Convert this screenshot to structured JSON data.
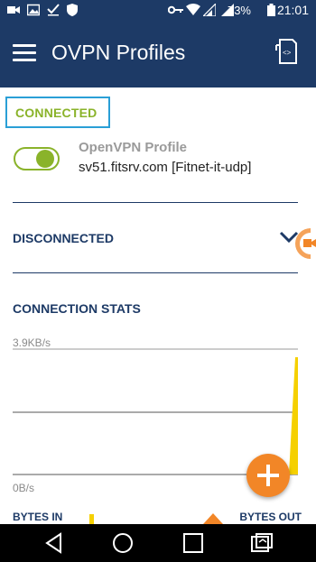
{
  "status_bar": {
    "battery_percent": "73%",
    "time": "21:01"
  },
  "app_bar": {
    "title": "OVPN Profiles"
  },
  "connected_section": {
    "header": "CONNECTED",
    "profile": {
      "name": "OpenVPN Profile",
      "server": "sv51.fitsrv.com [Fitnet-it-udp]",
      "toggle_on": true
    }
  },
  "disconnected_section": {
    "header": "DISCONNECTED"
  },
  "stats": {
    "header": "CONNECTION STATS",
    "y_top_label": "3.9KB/s",
    "y_bottom_label": "0B/s",
    "bytes_in_label": "BYTES IN",
    "bytes_out_label": "BYTES OUT"
  },
  "colors": {
    "primary": "#1d3a66",
    "connected_green": "#8ab32a",
    "highlight_border": "#2a9fd6",
    "fab_orange": "#f28627",
    "graph_yellow": "#f5d000"
  }
}
